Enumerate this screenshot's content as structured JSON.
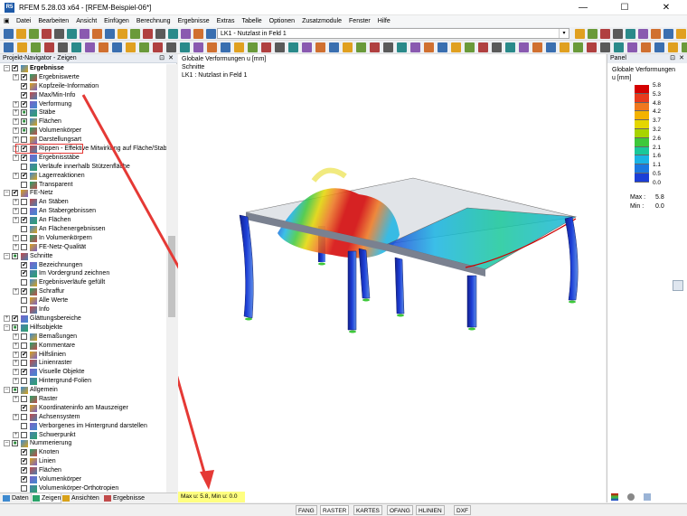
{
  "window": {
    "title": "RFEM 5.28.03 x64 - [RFEM-Beispiel-06*]",
    "app_icon_text": "R5",
    "minimize": "—",
    "maximize": "☐",
    "close": "✕"
  },
  "menu": [
    "Datei",
    "Bearbeiten",
    "Ansicht",
    "Einfügen",
    "Berechnung",
    "Ergebnisse",
    "Extras",
    "Tabelle",
    "Optionen",
    "Zusatzmodule",
    "Fenster",
    "Hilfe"
  ],
  "toolbar": {
    "loadcase": "LK1 - Nutzlast in Feld 1",
    "loadcase_arrow": "▾"
  },
  "navigator": {
    "title": "Projekt-Navigator - Zeigen",
    "pin": "⊡",
    "close": "✕",
    "tree": [
      {
        "level": 0,
        "exp": "–",
        "chk": "✔",
        "label": "Ergebnisse",
        "bold": true,
        "icon": "results-icon"
      },
      {
        "level": 1,
        "exp": "+",
        "chk": "✔",
        "label": "Ergebniswerte",
        "icon": "results-values-icon"
      },
      {
        "level": 1,
        "exp": "",
        "chk": "✔",
        "label": "Kopfzeile-Information",
        "icon": "header-info-icon"
      },
      {
        "level": 1,
        "exp": "",
        "chk": "✔",
        "label": "Max/Min-Info",
        "icon": "maxmin-info-icon"
      },
      {
        "level": 1,
        "exp": "+",
        "chk": "✔",
        "label": "Verformung",
        "icon": "deformation-icon"
      },
      {
        "level": 1,
        "exp": "+",
        "chk": "■",
        "label": "Stäbe",
        "icon": "members-icon"
      },
      {
        "level": 1,
        "exp": "+",
        "chk": "■",
        "label": "Flächen",
        "icon": "surfaces-icon"
      },
      {
        "level": 1,
        "exp": "+",
        "chk": "■",
        "label": "Volumenkörper",
        "icon": "solids-icon"
      },
      {
        "level": 1,
        "exp": "+",
        "chk": "",
        "label": "Darstellungsart",
        "icon": "display-type-icon"
      },
      {
        "level": 1,
        "exp": "+",
        "chk": "✔",
        "label": "Rippen - Effektive Mitwirkung auf Fläche/Stab",
        "icon": "ribs-icon"
      },
      {
        "level": 1,
        "exp": "+",
        "chk": "✔",
        "label": "Ergebnisstäbe",
        "icon": "result-beams-icon"
      },
      {
        "level": 1,
        "exp": "",
        "chk": "",
        "label": "Verläufe innerhalb Stützenfläche",
        "icon": "column-area-icon"
      },
      {
        "level": 1,
        "exp": "+",
        "chk": "✔",
        "label": "Lagerreaktionen",
        "icon": "support-reactions-icon"
      },
      {
        "level": 1,
        "exp": "",
        "chk": "",
        "label": "Transparent",
        "icon": "transparent-icon"
      },
      {
        "level": 0,
        "exp": "–",
        "chk": "✔",
        "label": "FE-Netz",
        "icon": "fe-mesh-icon"
      },
      {
        "level": 1,
        "exp": "+",
        "chk": "",
        "label": "An Stäben",
        "icon": "mesh-members-icon"
      },
      {
        "level": 1,
        "exp": "+",
        "chk": "",
        "label": "An Stabergebnissen",
        "icon": "mesh-member-results-icon"
      },
      {
        "level": 1,
        "exp": "+",
        "chk": "✔",
        "label": "An Flächen",
        "icon": "mesh-surfaces-icon"
      },
      {
        "level": 1,
        "exp": "",
        "chk": "",
        "label": "An Flächenergebnissen",
        "icon": "mesh-surface-results-icon"
      },
      {
        "level": 1,
        "exp": "+",
        "chk": "",
        "label": "In Volumenkörpern",
        "icon": "mesh-solids-icon"
      },
      {
        "level": 1,
        "exp": "+",
        "chk": "",
        "label": "FE-Netz-Qualität",
        "icon": "mesh-quality-icon"
      },
      {
        "level": 0,
        "exp": "–",
        "chk": "■",
        "label": "Schnitte",
        "icon": "sections-icon"
      },
      {
        "level": 1,
        "exp": "",
        "chk": "✔",
        "label": "Bezeichnungen",
        "icon": "labels-icon"
      },
      {
        "level": 1,
        "exp": "",
        "chk": "✔",
        "label": "Im Vordergrund zeichnen",
        "icon": "foreground-icon"
      },
      {
        "level": 1,
        "exp": "",
        "chk": "",
        "label": "Ergebnisverläufe gefüllt",
        "icon": "filled-results-icon"
      },
      {
        "level": 1,
        "exp": "+",
        "chk": "✔",
        "label": "Schraffur",
        "icon": "hatching-icon"
      },
      {
        "level": 1,
        "exp": "",
        "chk": "",
        "label": "Alle Werte",
        "icon": "all-values-icon"
      },
      {
        "level": 1,
        "exp": "",
        "chk": "",
        "label": "Info",
        "icon": "info-icon"
      },
      {
        "level": 0,
        "exp": "+",
        "chk": "✔",
        "label": "Glättungsbereiche",
        "icon": "smoothing-icon"
      },
      {
        "level": 0,
        "exp": "–",
        "chk": "■",
        "label": "Hilfsobjekte",
        "icon": "guide-objects-icon"
      },
      {
        "level": 1,
        "exp": "+",
        "chk": "",
        "label": "Bemaßungen",
        "icon": "dimensions-icon"
      },
      {
        "level": 1,
        "exp": "+",
        "chk": "",
        "label": "Kommentare",
        "icon": "comments-icon"
      },
      {
        "level": 1,
        "exp": "+",
        "chk": "✔",
        "label": "Hilfslinien",
        "icon": "guide-lines-icon"
      },
      {
        "level": 1,
        "exp": "+",
        "chk": "",
        "label": "Linienraster",
        "icon": "line-grid-icon"
      },
      {
        "level": 1,
        "exp": "+",
        "chk": "✔",
        "label": "Visuelle Objekte",
        "icon": "visual-objects-icon"
      },
      {
        "level": 1,
        "exp": "+",
        "chk": "",
        "label": "Hintergrund-Folien",
        "icon": "background-layers-icon"
      },
      {
        "level": 0,
        "exp": "–",
        "chk": "■",
        "label": "Allgemein",
        "icon": "general-icon"
      },
      {
        "level": 1,
        "exp": "+",
        "chk": "",
        "label": "Raster",
        "icon": "grid-icon"
      },
      {
        "level": 1,
        "exp": "",
        "chk": "✔",
        "label": "Koordinateninfo am Mauszeiger",
        "icon": "coordinate-info-icon"
      },
      {
        "level": 1,
        "exp": "+",
        "chk": "",
        "label": "Achsensystem",
        "icon": "axis-system-icon"
      },
      {
        "level": 1,
        "exp": "",
        "chk": "",
        "label": "Verborgenes im Hintergrund darstellen",
        "icon": "hidden-background-icon"
      },
      {
        "level": 1,
        "exp": "+",
        "chk": "",
        "label": "Schwerpunkt",
        "icon": "centroid-icon"
      },
      {
        "level": 0,
        "exp": "–",
        "chk": "■",
        "label": "Nummerierung",
        "icon": "numbering-icon"
      },
      {
        "level": 1,
        "exp": "",
        "chk": "✔",
        "label": "Knoten",
        "icon": "nodes-numbering-icon"
      },
      {
        "level": 1,
        "exp": "",
        "chk": "✔",
        "label": "Linien",
        "icon": "lines-numbering-icon"
      },
      {
        "level": 1,
        "exp": "",
        "chk": "✔",
        "label": "Flächen",
        "icon": "surfaces-numbering-icon"
      },
      {
        "level": 1,
        "exp": "",
        "chk": "✔",
        "label": "Volumenkörper",
        "icon": "solids-numbering-icon"
      },
      {
        "level": 1,
        "exp": "",
        "chk": "",
        "label": "Volumenkörper-Orthotropien",
        "icon": "solid-orthotropy-icon"
      }
    ],
    "tabs": [
      "Daten",
      "Zeigen",
      "Ansichten",
      "Ergebnisse"
    ]
  },
  "canvas": {
    "header": [
      "Globale Verformungen u [mm]",
      "Schnitte",
      "LK1 : Nutzlast in Feld 1"
    ],
    "status_info": "Max u: 5.8, Min u: 0.0 mm"
  },
  "panel": {
    "title": "Panel",
    "pin": "⊡",
    "close": "✕",
    "heading": "Globale Verformungen",
    "unit": "u [mm]",
    "legend_values": [
      "5.8",
      "5.3",
      "4.8",
      "4.2",
      "3.7",
      "3.2",
      "2.6",
      "2.1",
      "1.6",
      "1.1",
      "0.5",
      "0.0"
    ],
    "legend_colors": [
      "#d40000",
      "#e83a1d",
      "#f0781e",
      "#f3b200",
      "#e4d600",
      "#a8d400",
      "#3ec83a",
      "#19c89a",
      "#1ab4e4",
      "#1b78e0",
      "#1c3ed6",
      "#13208e"
    ],
    "max_label": "Max :",
    "max_value": "5.8",
    "min_label": "Min :",
    "min_value": "0.0"
  },
  "statusbar": [
    "FANG",
    "RASTER",
    "KARTES",
    "OFANG",
    "HLINIEN",
    "DXF"
  ],
  "statusbar_active": "RASTER"
}
